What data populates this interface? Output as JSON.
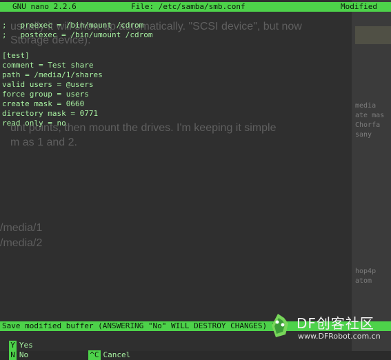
{
  "titlebar": {
    "app": "GNU nano 2.2.6",
    "file": "File: /etc/samba/smb.conf",
    "status": "Modified"
  },
  "editor": {
    "lines_top": [
      ";   preexec = /bin/mount /cdrom",
      ";   postexec = /bin/umount /cdrom"
    ],
    "lines_main": [
      "[test]",
      "comment = Test share",
      "path = /media/1/shares",
      "valid users = @users",
      "force group = users",
      "create mask = 0660",
      "directory mask = 0771",
      "read only = no"
    ]
  },
  "background_text": {
    "ghost1": "usually it will show up automatically. \"SCSI device\", but now",
    "ghost2": "   Storage device).",
    "ghost3": "unt points, then mount the drives. I'm keeping it simple",
    "ghost4": "m as 1 and 2.",
    "ghost5": "/media/1",
    "ghost6": "/media/2"
  },
  "right_panel": {
    "t1": "media",
    "t2": "ate mas",
    "t3": "Chorfa",
    "t4": "sany",
    "t5": "hop4p",
    "t6": "atom"
  },
  "prompt": {
    "text": "Save modified buffer (ANSWERING \"No\" WILL DESTROY CHANGES) ?"
  },
  "shortcuts": {
    "yes_key": "Y",
    "yes_label": "Yes",
    "no_key": "N",
    "no_label": "No",
    "cancel_key": "^C",
    "cancel_label": "Cancel"
  },
  "watermark": {
    "brand": "DF创客社区",
    "url": "www.DFRobot.com.cn"
  },
  "colors": {
    "accent": "#4dd24a",
    "text": "#a7f0a1",
    "background": "#2b2b2b"
  }
}
